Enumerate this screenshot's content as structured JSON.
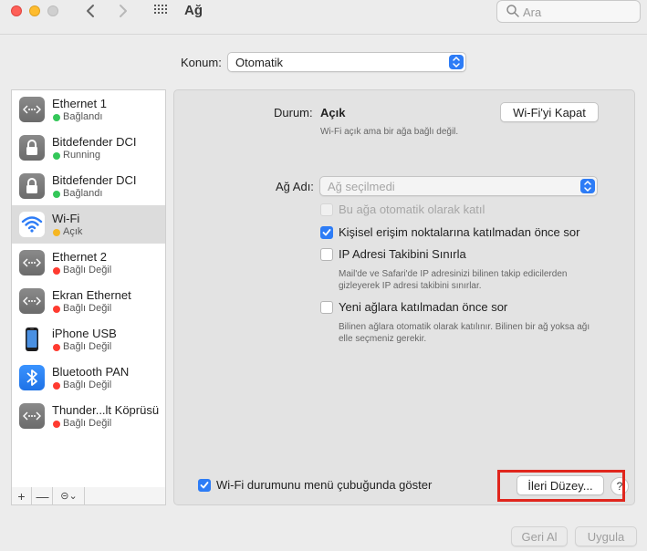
{
  "window": {
    "title": "Ağ"
  },
  "search": {
    "placeholder": "Ara"
  },
  "location": {
    "label": "Konum:",
    "value": "Otomatik"
  },
  "services": [
    {
      "name": "Ethernet 1",
      "status": "Bağlandı",
      "status_color": "#34c759",
      "icon": "ethernet-icon"
    },
    {
      "name": "Bitdefender DCI",
      "status": "Running",
      "status_color": "#34c759",
      "icon": "lock-icon"
    },
    {
      "name": "Bitdefender DCI",
      "status": "Bağlandı",
      "status_color": "#34c759",
      "icon": "lock-icon"
    },
    {
      "name": "Wi-Fi",
      "status": "Açık",
      "status_color": "#f5b622",
      "icon": "wifi-icon",
      "selected": true
    },
    {
      "name": "Ethernet 2",
      "status": "Bağlı Değil",
      "status_color": "#ff3b30",
      "icon": "ethernet-icon"
    },
    {
      "name": "Ekran Ethernet",
      "status": "Bağlı Değil",
      "status_color": "#ff3b30",
      "icon": "ethernet-icon"
    },
    {
      "name": "iPhone USB",
      "status": "Bağlı Değil",
      "status_color": "#ff3b30",
      "icon": "iphone-icon"
    },
    {
      "name": "Bluetooth PAN",
      "status": "Bağlı Değil",
      "status_color": "#ff3b30",
      "icon": "bluetooth-icon"
    },
    {
      "name": "Thunder...lt Köprüsü",
      "status": "Bağlı Değil",
      "status_color": "#ff3b30",
      "icon": "ethernet-icon"
    }
  ],
  "sidebar_buttons": {
    "add": "+",
    "remove": "—",
    "action": "⊝⌄"
  },
  "status": {
    "label": "Durum:",
    "value": "Açık",
    "toggle_button": "Wi-Fi'yi Kapat",
    "description": "Wi-Fi açık ama bir ağa bağlı değil."
  },
  "network": {
    "label": "Ağ Adı:",
    "placeholder": "Ağ seçilmedi"
  },
  "options": {
    "auto_join": {
      "label": "Bu ağa otomatik olarak katıl",
      "checked": false,
      "disabled": true
    },
    "hotspot": {
      "label": "Kişisel erişim noktalarına katılmadan önce sor",
      "checked": true
    },
    "ip_tracking": {
      "label": "IP Adresi Takibini Sınırla",
      "checked": false,
      "note_line1": "Mail'de ve Safari'de IP adresinizi bilinen takip edicilerden",
      "note_line2": "gizleyerek IP adresi takibini sınırlar."
    },
    "ask_new": {
      "label": "Yeni ağlara katılmadan önce sor",
      "checked": false,
      "note_line1": "Bilinen ağlara otomatik olarak katılınır. Bilinen bir ağ yoksa ağı",
      "note_line2": "elle seçmeniz gerekir."
    },
    "menu_bar": {
      "label": "Wi-Fi durumunu menü çubuğunda göster",
      "checked": true
    }
  },
  "footer": {
    "advanced": "İleri Düzey...",
    "help": "?",
    "revert": "Geri Al",
    "apply": "Uygula"
  },
  "colors": {
    "accent": "#2d7cf6",
    "highlight": "#e0261d"
  }
}
